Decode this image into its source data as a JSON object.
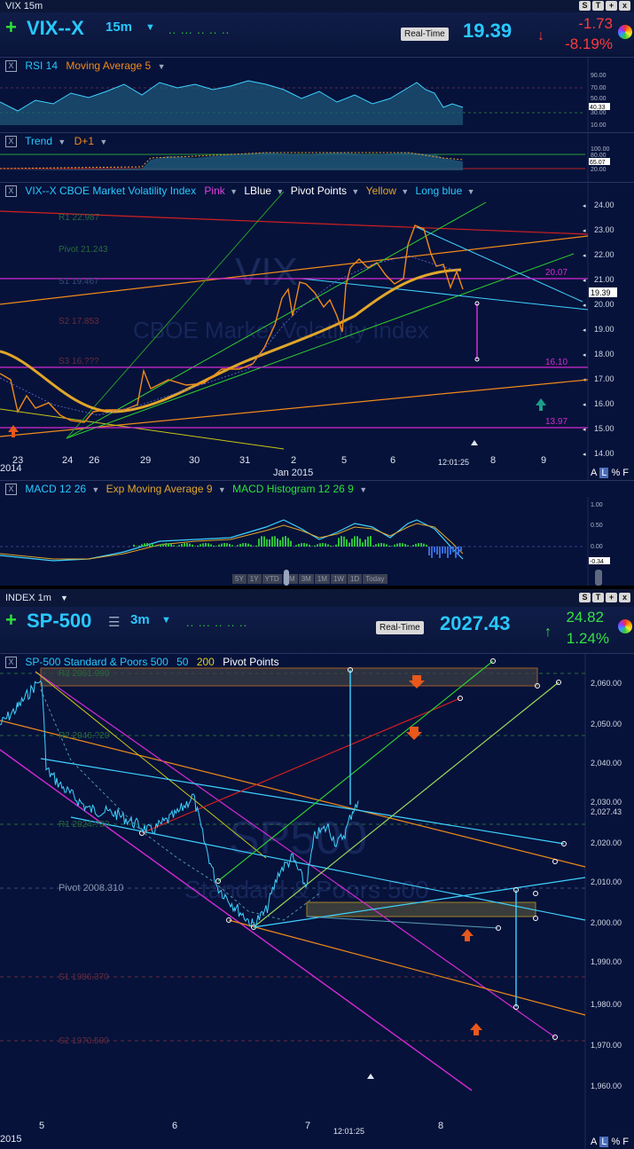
{
  "vix": {
    "window_label": "VIX 15m",
    "symbol": "VIX--X",
    "timeframe": "15m",
    "realtime_label": "Real-Time",
    "price": "19.39",
    "change": "-1.73",
    "change_pct": "-8.19%",
    "rsi_header": [
      "RSI 14",
      "Moving Average 5"
    ],
    "rsi_levels": [
      "90.00",
      "70.00",
      "50.00",
      "40.33",
      "30.00",
      "10.00"
    ],
    "trend_header": [
      "Trend",
      "D+1"
    ],
    "trend_levels": [
      "100.00",
      "80.00",
      "65.07",
      "20.00"
    ],
    "main_header": [
      "VIX--X CBOE Market Volatility Index",
      "Pink",
      "LBlue",
      "Pivot Points",
      "Yellow",
      "Long blue"
    ],
    "watermark": "VIX",
    "watermark2": "CBOE Market Volatility Index",
    "pivot_labels": [
      "R1 22.987",
      "Pivot 21.243",
      "S1 19.467",
      "S2 17.853",
      "S3 16.???"
    ],
    "price_labels": [
      "20.07",
      "16.10",
      "13.97"
    ],
    "y_ticks": [
      "24.00",
      "23.00",
      "22.00",
      "21.00",
      "20.00",
      "19.00",
      "18.00",
      "17.00",
      "16.00",
      "15.00",
      "14.00"
    ],
    "x_labels": [
      "2014",
      "23",
      "24",
      "26",
      "29",
      "30",
      "31",
      "2",
      "Jan 2015",
      "5",
      "6",
      "8",
      "9"
    ],
    "time_label": "12:01:25",
    "macd_header": [
      "MACD 12 26",
      "Exp Moving Average 9",
      "MACD Histogram 12 26 9"
    ],
    "macd_levels": [
      "1.00",
      "0.50",
      "0.00",
      "-0.34"
    ],
    "range_buttons": [
      "5Y",
      "1Y",
      "YTD",
      "6M",
      "3M",
      "1M",
      "1W",
      "1D",
      "Today"
    ],
    "corner_icons": [
      "A",
      "L",
      "%",
      "F"
    ]
  },
  "sp": {
    "window_label": "INDEX 1m",
    "symbol": "SP-500",
    "timeframe": "3m",
    "realtime_label": "Real-Time",
    "price": "2027.43",
    "change": "24.82",
    "change_pct": "1.24%",
    "main_header": [
      "SP-500 Standard & Poors 500",
      "50",
      "200",
      "Pivot Points"
    ],
    "watermark": "SP500",
    "watermark2": "Standard & Poors 500",
    "pivot_labels": [
      "R3 2061.990",
      "R2 2046.?20",
      "R1 2024.?30",
      "Pivot 2008.310",
      "S1 1986.370",
      "S2 1970.500"
    ],
    "y_ticks": [
      "2,060.00",
      "2,050.00",
      "2,040.00",
      "2,030.00",
      "2,027.43",
      "2,020.00",
      "2,010.00",
      "2,000.00",
      "1,990.00",
      "1,980.00",
      "1,970.00",
      "1,960.00"
    ],
    "x_labels": [
      "2015",
      "5",
      "6",
      "7",
      "8"
    ],
    "time_label": "12:01:25",
    "corner_icons": [
      "A",
      "L",
      "%",
      "F"
    ]
  },
  "colors": {
    "background": "#06123a",
    "price_up": "#35e046",
    "price_down": "#ff3b3b",
    "symbol": "#29c8ff",
    "pink": "#d42ad4",
    "orange": "#f08a1a"
  }
}
